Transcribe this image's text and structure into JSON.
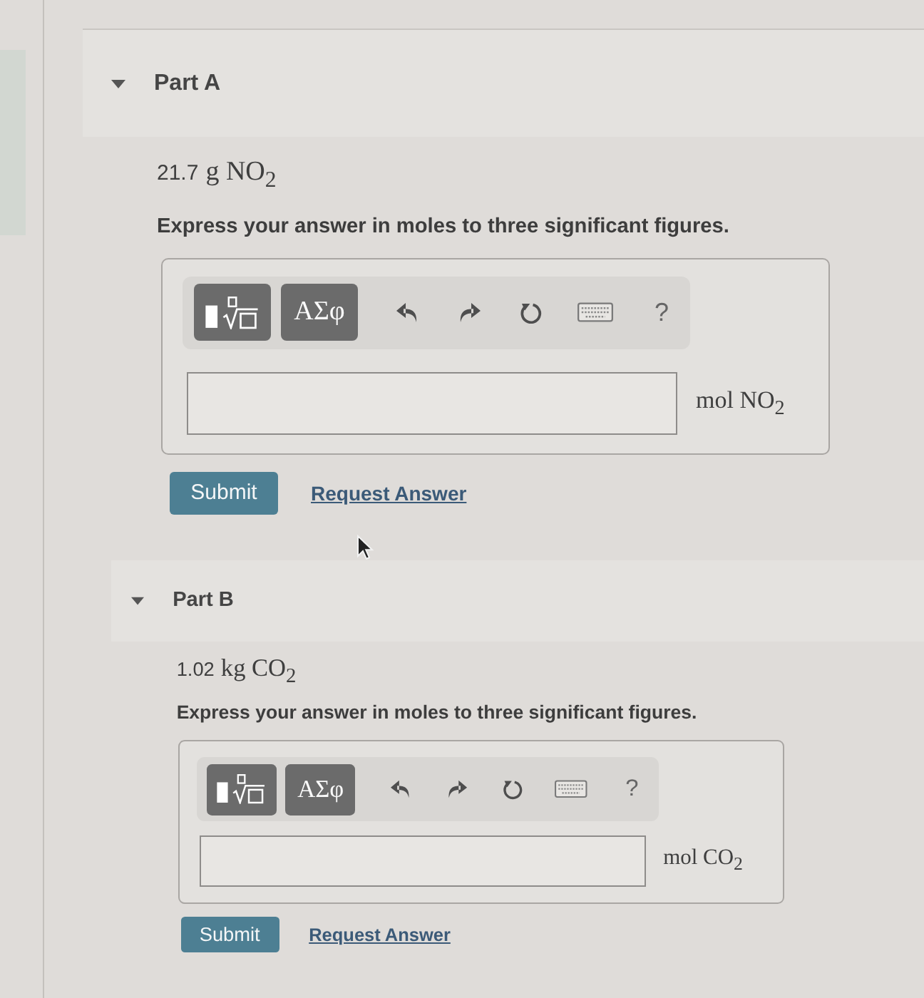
{
  "parts": [
    {
      "title": "Part A",
      "expanded": true,
      "quantity": {
        "value": "21.7",
        "unit": "g NO$_{2}$"
      },
      "instruction": "Express your answer in moles to three significant figures.",
      "toolbar": [
        {
          "kind": "templates"
        },
        {
          "kind": "symbols",
          "label": "ΑΣφ"
        },
        {
          "kind": "undo"
        },
        {
          "kind": "redo"
        },
        {
          "kind": "reset"
        },
        {
          "kind": "keyboard"
        },
        {
          "kind": "help",
          "label": "?"
        }
      ],
      "answer_unit": "mol NO$_{2}$",
      "submit": "Submit",
      "request_answer": "Request Answer"
    },
    {
      "title": "Part B",
      "expanded": true,
      "quantity": {
        "value": "1.02",
        "unit": "kg CO$_{2}$"
      },
      "instruction": "Express your answer in moles to three significant figures.",
      "toolbar": [
        {
          "kind": "templates"
        },
        {
          "kind": "symbols",
          "label": "ΑΣφ"
        },
        {
          "kind": "undo"
        },
        {
          "kind": "redo"
        },
        {
          "kind": "reset"
        },
        {
          "kind": "keyboard"
        },
        {
          "kind": "help",
          "label": "?"
        }
      ],
      "answer_unit": "mol CO$_{2}$",
      "submit": "Submit",
      "request_answer": "Request Answer"
    }
  ]
}
